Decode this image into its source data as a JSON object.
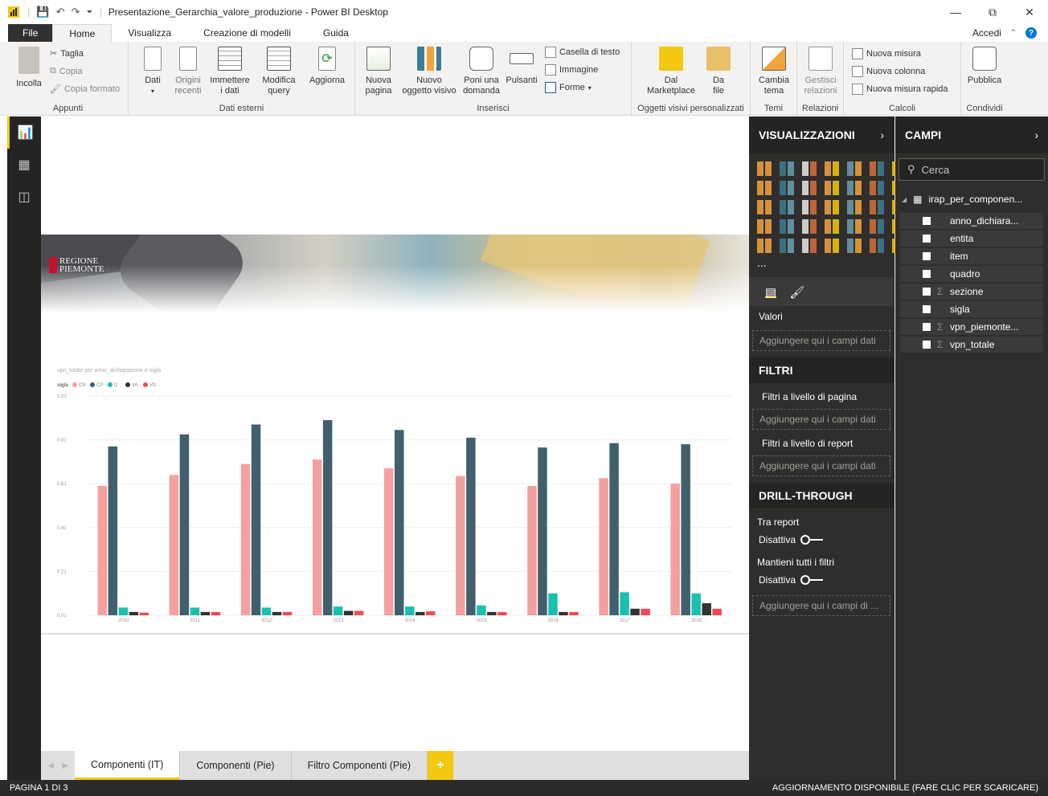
{
  "window": {
    "title": "Presentazione_Gerarchia_valore_produzione - Power BI Desktop"
  },
  "menu_tabs": [
    "File",
    "Home",
    "Visualizza",
    "Creazione di modelli",
    "Guida"
  ],
  "account": {
    "signin": "Accedi"
  },
  "ribbon": {
    "appunti": {
      "label": "Appunti",
      "incolla": "Incolla",
      "taglia": "Taglia",
      "copia": "Copia",
      "copia_formato": "Copia formato"
    },
    "dati_esterni": {
      "label": "Dati esterni",
      "dati": "Dati",
      "origini": "Origini\nrecenti",
      "immettere": "Immettere\ni dati",
      "modifica": "Modifica\nquery",
      "aggiorna": "Aggiorna"
    },
    "inserisci": {
      "label": "Inserisci",
      "nuova_pagina": "Nuova\npagina",
      "nuovo_oggetto": "Nuovo\noggetto visivo",
      "poni": "Poni una\ndomanda",
      "pulsanti": "Pulsanti",
      "casella": "Casella di testo",
      "immagine": "Immagine",
      "forme": "Forme"
    },
    "oggetti": {
      "label": "Oggetti visivi personalizzati",
      "marketplace": "Dal\nMarketplace",
      "da_file": "Da\nfile"
    },
    "temi": {
      "label": "Temi",
      "cambia": "Cambia\ntema"
    },
    "relazioni": {
      "label": "Relazioni",
      "gestisci": "Gestisci\nrelazioni"
    },
    "calcoli": {
      "label": "Calcoli",
      "nuova_misura": "Nuova misura",
      "nuova_colonna": "Nuova colonna",
      "misura_rapida": "Nuova misura rapida"
    },
    "condividi": {
      "label": "Condividi",
      "pubblica": "Pubblica"
    }
  },
  "banner": {
    "logo_line1": "REGIONE",
    "logo_line2": "PIEMONTE"
  },
  "chart_data": {
    "type": "bar",
    "title": "vpn_totale per anno_dichiarazione e sigla",
    "legend_title": "sigla",
    "categories": [
      "2010",
      "2011",
      "2012",
      "2013",
      "2014",
      "2015",
      "2016",
      "2017",
      "2018"
    ],
    "series": [
      {
        "name": "CN",
        "color": "#f4a09f",
        "values": [
          0.6,
          0.65,
          0.7,
          0.72,
          0.68,
          0.645,
          0.6,
          0.635,
          0.61
        ]
      },
      {
        "name": "CP",
        "color": "#41606e",
        "values": [
          0.78,
          0.835,
          0.88,
          0.9,
          0.855,
          0.82,
          0.775,
          0.795,
          0.79
        ]
      },
      {
        "name": "D",
        "color": "#1bbfae",
        "values": [
          0.045,
          0.045,
          0.045,
          0.05,
          0.05,
          0.055,
          0.11,
          0.115,
          0.11
        ]
      },
      {
        "name": "VA",
        "color": "#333333",
        "values": [
          0.025,
          0.025,
          0.025,
          0.03,
          0.025,
          0.025,
          0.025,
          0.04,
          0.065
        ]
      },
      {
        "name": "VD",
        "color": "#f0495a",
        "values": [
          0.022,
          0.025,
          0.025,
          0.03,
          0.028,
          0.025,
          0.025,
          0.04,
          0.04
        ]
      }
    ],
    "yticks": [
      "1,01",
      "0,81",
      "0,61",
      "0,41",
      "0,21",
      "0,01"
    ],
    "ylim": [
      0.01,
      1.01
    ],
    "grid": true
  },
  "page_tabs": {
    "tabs": [
      "Componenti (IT)",
      "Componenti (Pie)",
      "Filtro  Componenti (Pie)"
    ],
    "add": "+"
  },
  "viz_pane": {
    "title": "VISUALIZZAZIONI",
    "more": "...",
    "valori_label": "Valori",
    "valori_drop": "Aggiungere qui i campi dati",
    "filtri_title": "FILTRI",
    "filtri_pagina": "Filtri a livello di pagina",
    "filtri_pagina_drop": "Aggiungere qui i campi dati",
    "filtri_report": "Filtri a livello di report",
    "filtri_report_drop": "Aggiungere qui i campi dati",
    "drill_title": "DRILL-THROUGH",
    "tra_report": "Tra report",
    "disattiva1": "Disattiva",
    "mantieni": "Mantieni tutti i filtri",
    "disattiva2": "Disattiva",
    "drill_drop": "Aggiungere qui i campi di ..."
  },
  "fields_pane": {
    "title": "CAMPI",
    "search_placeholder": "Cerca",
    "table": "irap_per_componen...",
    "fields": [
      {
        "name": "anno_dichiara...",
        "sigma": ""
      },
      {
        "name": "entita",
        "sigma": ""
      },
      {
        "name": "item",
        "sigma": ""
      },
      {
        "name": "quadro",
        "sigma": ""
      },
      {
        "name": "sezione",
        "sigma": "Σ"
      },
      {
        "name": "sigla",
        "sigma": ""
      },
      {
        "name": "vpn_piemonte...",
        "sigma": "Σ"
      },
      {
        "name": "vpn_totale",
        "sigma": "Σ"
      }
    ]
  },
  "status": {
    "left": "PAGINA 1 DI 3",
    "right": "AGGIORNAMENTO DISPONIBILE (FARE CLIC PER SCARICARE)"
  }
}
